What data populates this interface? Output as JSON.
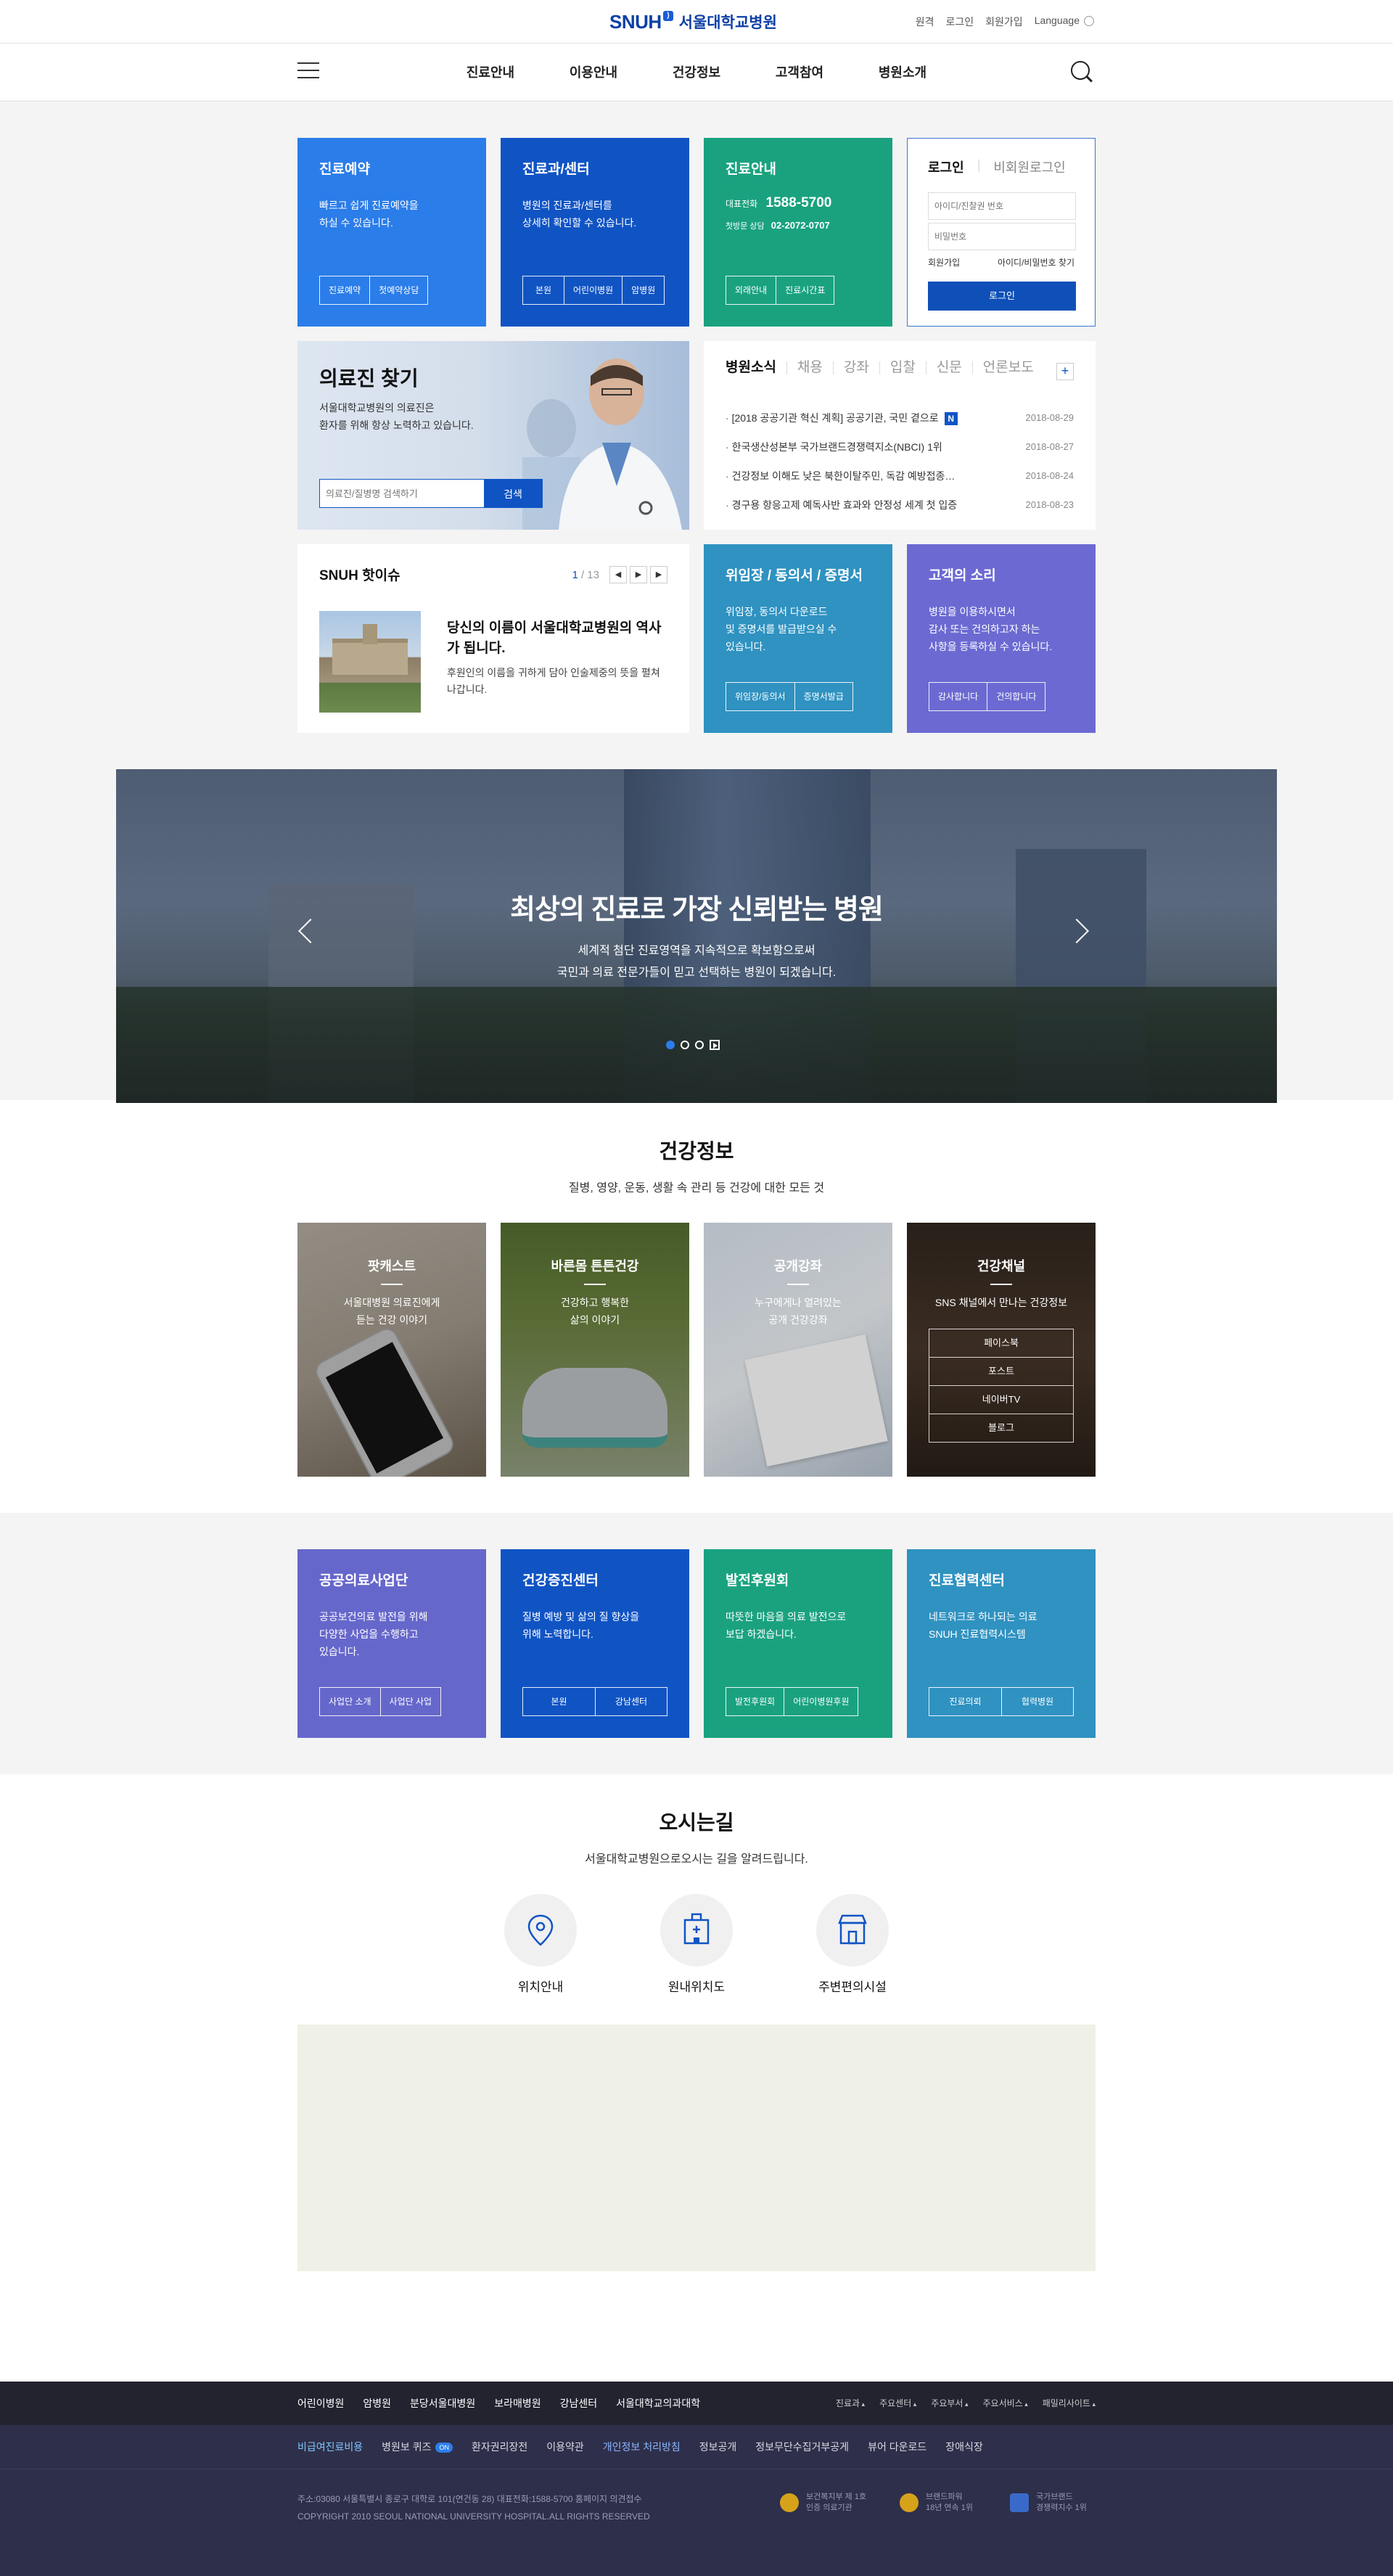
{
  "header": {
    "logo_brand": "SNUH",
    "logo_name": "서울대학교병원",
    "util": [
      "원격",
      "로그인",
      "회원가입",
      "Language"
    ],
    "gnb": [
      "진료안내",
      "이용안내",
      "건강정보",
      "고객참여",
      "병원소개"
    ]
  },
  "cards": {
    "reserve": {
      "title": "진료예약",
      "desc": "빠르고 쉽게 진료예약을\n하실 수 있습니다.",
      "buttons": [
        "진료예약",
        "첫예약상담"
      ]
    },
    "dept": {
      "title": "진료과/센터",
      "desc": "병원의 진료과/센터를\n상세히 확인할 수 있습니다.",
      "buttons": [
        "본원",
        "어린이병원",
        "암병원"
      ]
    },
    "guide": {
      "title": "진료안내",
      "tel_label": "대표전화",
      "tel": "1588-5700",
      "first_label": "첫방문 상담",
      "first_tel": "02-2072-0707",
      "buttons": [
        "외래안내",
        "진료시간표"
      ]
    }
  },
  "login": {
    "tab_on": "로그인",
    "tab_off": "비회원로그인",
    "id_placeholder": "아이디/진찰권 번호",
    "pw_placeholder": "비밀번호",
    "join": "회원가입",
    "find": "아이디/비밀번호 찾기",
    "button": "로그인"
  },
  "doctor": {
    "title": "의료진 찾기",
    "desc": "서울대학교병원의 의료진은\n환자를 위해 항상 노력하고 있습니다.",
    "placeholder": "의료진/질병명 검색하기",
    "search": "검색"
  },
  "news": {
    "tabs": [
      "병원소식",
      "채용",
      "강좌",
      "입찰",
      "신문",
      "언론보도"
    ],
    "more": "+",
    "new_badge": "N",
    "items": [
      {
        "title": "[2018 공공기관 혁신 계획] 공공기관, 국민 곁으로",
        "date": "2018-08-29"
      },
      {
        "title": "한국생산성본부 국가브랜드경쟁력지소(NBCI) 1위",
        "date": "2018-08-27"
      },
      {
        "title": "건강정보 이해도 낮은 북한이탈주민, 독감 예방접종…",
        "date": "2018-08-24"
      },
      {
        "title": "경구용 항응고제 예독사반 효과와 안정성 세계 첫 입증",
        "date": "2018-08-23"
      }
    ]
  },
  "hot": {
    "title": "SNUH 핫이슈",
    "page": "1",
    "total": "/ 13",
    "controls": [
      "◀",
      "▶",
      "▶"
    ],
    "headline": "당신의 이름이 서울대학교병원의 역사가 됩니다.",
    "desc": "후원인의 이름을 귀하게 담아 인술제중의 뜻을 펼쳐 나갑니다."
  },
  "cert": {
    "title": "위임장 / 동의서 / 증명서",
    "desc": "위임장, 동의서 다운로드\n및 증명서를 발급받으실 수\n있습니다.",
    "buttons": [
      "위임장/동의서",
      "증명서발급"
    ]
  },
  "voice": {
    "title": "고객의 소리",
    "desc": "병원을 이용하시면서\n감사 또는 건의하고자 하는\n사항을 등록하실 수 있습니다.",
    "buttons": [
      "감사합니다",
      "건의합니다"
    ]
  },
  "banner": {
    "title": "최상의 진료로 가장 신뢰받는 병원",
    "desc": "세계적 첨단 진료영역을 지속적으로 확보함으로써\n국민과 의료 전문가들이 믿고 선택하는 병원이 되겠습니다."
  },
  "health": {
    "title": "건강정보",
    "subtitle": "질병, 영양, 운동, 생활 속 관리 등 건강에 대한 모든 것",
    "cards": [
      {
        "title": "팟캐스트",
        "desc": "서울대병원 의료진에게\n듣는 건강 이야기"
      },
      {
        "title": "바른몸 튼튼건강",
        "desc": "건강하고 행복한\n삶의 이야기"
      },
      {
        "title": "공개강좌",
        "desc": "누구에게나 열려있는\n공개 건강강좌"
      },
      {
        "title": "건강채널",
        "desc": "SNS 채널에서 만나는 건강정보",
        "links": [
          "페이스북",
          "포스트",
          "네이버TV",
          "블로그"
        ]
      }
    ]
  },
  "centers": [
    {
      "title": "공공의료사업단",
      "desc": "공공보건의료 발전을 위해\n다양한 사업을 수행하고\n있습니다.",
      "buttons": [
        "사업단 소개",
        "사업단 사업"
      ]
    },
    {
      "title": "건강증진센터",
      "desc": "질병 예방 및 삶의 질 향상을\n위해 노력합니다.",
      "buttons": [
        "본원",
        "강남센터"
      ]
    },
    {
      "title": "발전후원회",
      "desc": "따뜻한 마음을 의료 발전으로\n보답 하겠습니다.",
      "buttons": [
        "발전후원회",
        "어린이병원후원"
      ]
    },
    {
      "title": "진료협력센터",
      "desc": "네트워크로 하나되는 의료\nSNUH 진료협력시스템",
      "buttons": [
        "진료의뢰",
        "협력병원"
      ]
    }
  ],
  "directions": {
    "title": "오시는길",
    "subtitle": "서울대학교병원으로오시는 길을 알려드립니다.",
    "items": [
      "위치안내",
      "원내위치도",
      "주변편의시설"
    ]
  },
  "footer": {
    "family": [
      "어린이병원",
      "암병원",
      "분당서울대병원",
      "보라매병원",
      "강남센터",
      "서울대학교의과대학"
    ],
    "selects": [
      "진료과",
      "주요센터",
      "주요부서",
      "주요서비스",
      "패밀리사이트"
    ],
    "menu": [
      "비급여진료비용",
      "병원보 퀴즈",
      "환자권리장전",
      "이용약관",
      "개인정보 처리방침",
      "정보공개",
      "정보무단수집거부공게",
      "뷰어 다운로드",
      "장애식장"
    ],
    "quiz_badge": "ON",
    "address": "주소:03080 서울특별시 종로구 대학로 101(연건동 28)    대표전화:1588-5700    홈페이지 의견접수",
    "copyright": "COPYRIGHT 2010 SEOUL NATIONAL UNIVERSITY HOSPITAL.ALL RIGHTS RESERVED",
    "awards": [
      "보건복지부 제 1호\n인증 의료기관",
      "브랜드파워\n18년 연속 1위",
      "국가브랜드\n경쟁력지수 1위"
    ]
  },
  "colors": {
    "primary": "#1054c4",
    "blue": "#2b7de9",
    "green": "#1aa27f",
    "teal": "#2f92c1",
    "purple": "#6c6ad2",
    "footer": "#22232f"
  }
}
